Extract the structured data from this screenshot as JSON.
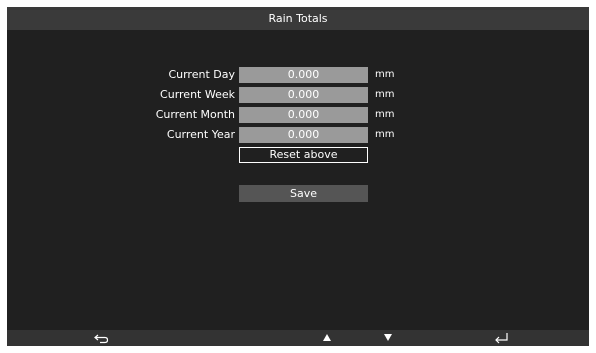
{
  "window": {
    "title": "Rain Totals"
  },
  "rain_totals": {
    "rows": [
      {
        "label": "Current Day",
        "value": "0.000",
        "unit": "mm"
      },
      {
        "label": "Current Week",
        "value": "0.000",
        "unit": "mm"
      },
      {
        "label": "Current Month",
        "value": "0.000",
        "unit": "mm"
      },
      {
        "label": "Current Year",
        "value": "0.000",
        "unit": "mm"
      }
    ],
    "reset_label": "Reset above",
    "save_label": "Save"
  },
  "footer": {
    "icons": [
      "back-icon",
      "up-arrow-icon",
      "down-arrow-icon",
      "enter-icon"
    ]
  },
  "colors": {
    "background": "#202020",
    "title_bar": "#3a3a3a",
    "value_field": "#9a9a9a",
    "save_button": "#555555",
    "footer": "#333333",
    "text": "#ffffff"
  }
}
